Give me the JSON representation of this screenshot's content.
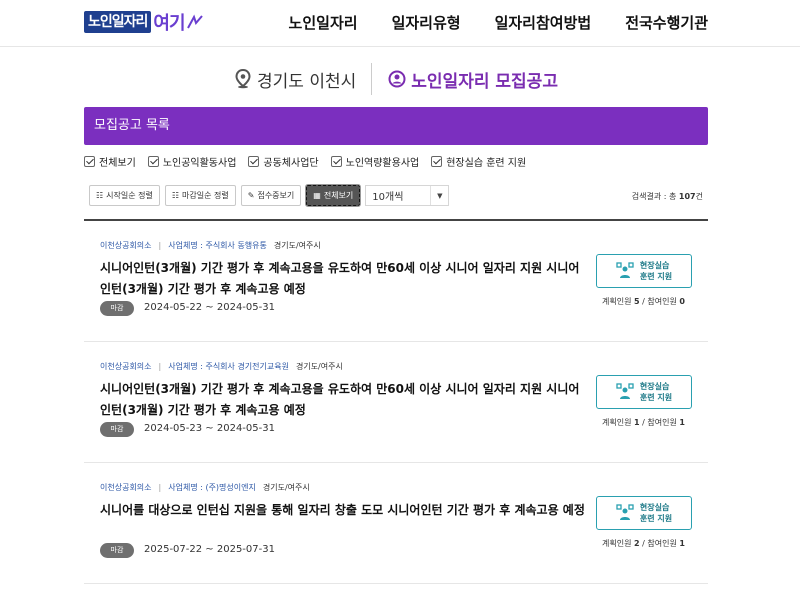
{
  "header": {
    "logo_main": "노인일자리",
    "logo_accent": "여기",
    "nav": [
      "노인일자리",
      "일자리유형",
      "일자리참여방법",
      "전국수행기관"
    ]
  },
  "title": {
    "location": "경기도 이천시",
    "notice": "노인일자리 모집공고"
  },
  "list_bar": "모집공고 목록",
  "filters": [
    "전체보기",
    "노인공익활동사업",
    "공동체사업단",
    "노인역량활용사업",
    "현장실습 훈련 지원"
  ],
  "toolbar": {
    "sort_start": "시작일순 정렬",
    "sort_end": "마감일순 정렬",
    "receiving": "접수중보기",
    "view_all": "전체보기",
    "page_size": "10개씩"
  },
  "result": {
    "prefix": "검색결과 : 총",
    "count": "107",
    "suffix": "건"
  },
  "items": [
    {
      "org": "이천상공회의소",
      "company": "사업체명 : 주식회사 동행유통",
      "region": "경기도/여주시",
      "title": "시니어인턴(3개월) 기간 평가 후 계속고용을 유도하여 만60세 이상 시니어 일자리 지원 시니어인턴(3개월) 기간 평가 후 계속고용 예정",
      "status": "마감",
      "date": "2024-05-22 ~ 2024-05-31",
      "train_line1": "현장실습",
      "train_line2": "훈련 지원",
      "plan_label": "계획인원",
      "plan": "5",
      "join_label": "참여인원",
      "join": "0"
    },
    {
      "org": "이천상공회의소",
      "company": "사업체명 : 주식회사 경기전기교육원",
      "region": "경기도/여주시",
      "title": "시니어인턴(3개월) 기간 평가 후 계속고용을 유도하여 만60세 이상 시니어 일자리 지원 시니어인턴(3개월) 기간 평가 후 계속고용 예정",
      "status": "마감",
      "date": "2024-05-23 ~ 2024-05-31",
      "train_line1": "현장실습",
      "train_line2": "훈련 지원",
      "plan_label": "계획인원",
      "plan": "1",
      "join_label": "참여인원",
      "join": "1"
    },
    {
      "org": "이천상공회의소",
      "company": "사업체명 : (주)명성이엔지",
      "region": "경기도/여주시",
      "title": "시니어를 대상으로 인턴십 지원을 통해 일자리 창출 도모 시니어인턴 기간 평가 후 계속고용 예정",
      "status": "마감",
      "date": "2025-07-22 ~ 2025-07-31",
      "train_line1": "현장실습",
      "train_line2": "훈련 지원",
      "plan_label": "계획인원",
      "plan": "2",
      "join_label": "참여인원",
      "join": "1"
    }
  ],
  "colors": {
    "brand_purple": "#7b2fbf",
    "logo_blue": "#1f3f8f",
    "teal": "#2aa0b0",
    "link_blue": "#2c57a6"
  }
}
